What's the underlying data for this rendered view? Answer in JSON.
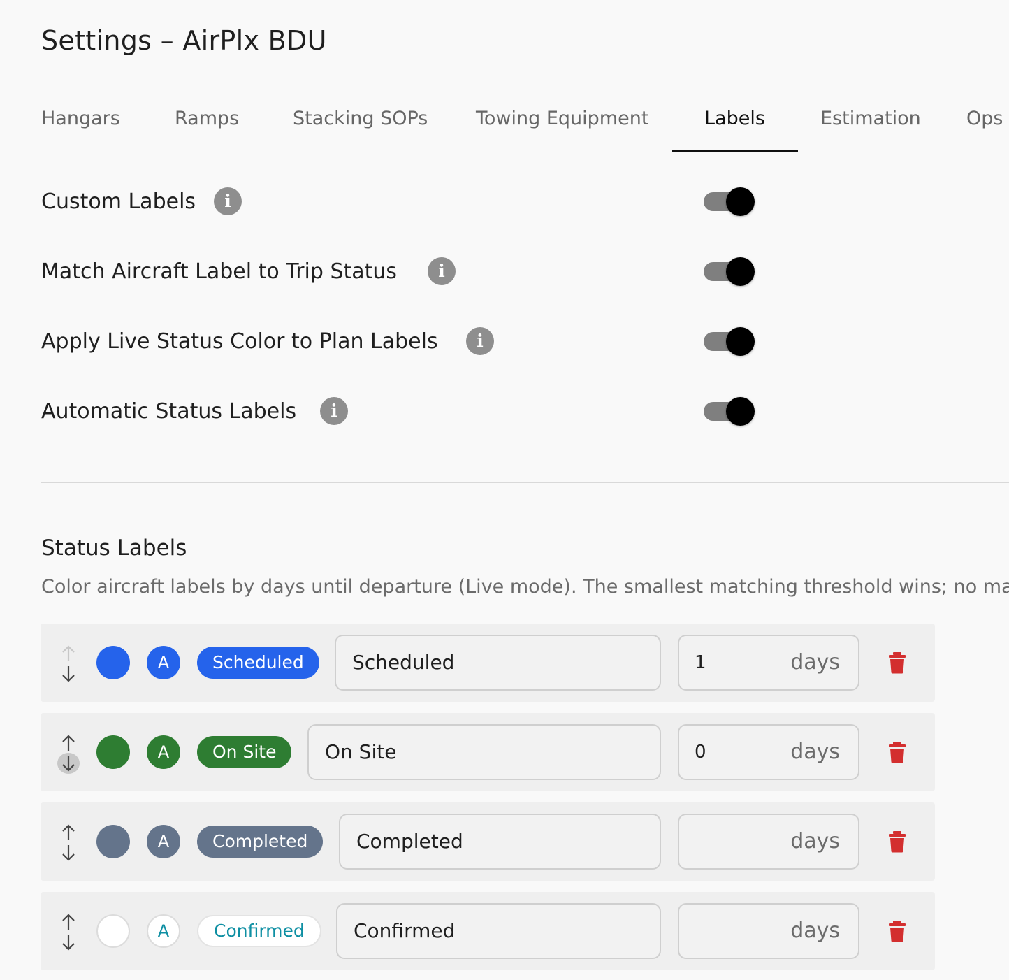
{
  "title": "Settings – AirPlx BDU",
  "tabs": [
    {
      "label": "Hangars",
      "active": false
    },
    {
      "label": "Ramps",
      "active": false
    },
    {
      "label": "Stacking SOPs",
      "active": false
    },
    {
      "label": "Towing Equipment",
      "active": false
    },
    {
      "label": "Labels",
      "active": true
    },
    {
      "label": "Estimation",
      "active": false
    },
    {
      "label": "Ops",
      "active": false
    }
  ],
  "settings": [
    {
      "label": "Custom Labels",
      "info_icon": "info-icon",
      "enabled": true
    },
    {
      "label": "Match Aircraft Label to Trip Status",
      "info_icon": "info-icon",
      "enabled": true
    },
    {
      "label": "Apply Live Status Color to Plan Labels",
      "info_icon": "info-icon",
      "enabled": true
    },
    {
      "label": "Automatic Status Labels",
      "info_icon": "info-icon",
      "enabled": true
    }
  ],
  "status_labels": {
    "title": "Status Labels",
    "description": "Color aircraft labels by days until departure (Live mode). The smallest matching threshold wins; no matching",
    "days_suffix": "days",
    "rows": [
      {
        "pill": "Scheduled",
        "name": "Scheduled",
        "days": "1",
        "letter": "A",
        "color": "#2563eb"
      },
      {
        "pill": "On Site",
        "name": "On Site",
        "days": "0",
        "letter": "A",
        "color": "#2e7d32"
      },
      {
        "pill": "Completed",
        "name": "Completed",
        "days": "",
        "letter": "A",
        "color": "#64748b"
      },
      {
        "pill": "Confirmed",
        "name": "Confirmed",
        "days": "",
        "letter": "A",
        "color": "#ffffff",
        "text_color": "#0e8fa3"
      }
    ]
  },
  "colors": {
    "delete": "#d32f2f",
    "toggle_knob": "#000000",
    "toggle_track": "#7f7f7f"
  }
}
